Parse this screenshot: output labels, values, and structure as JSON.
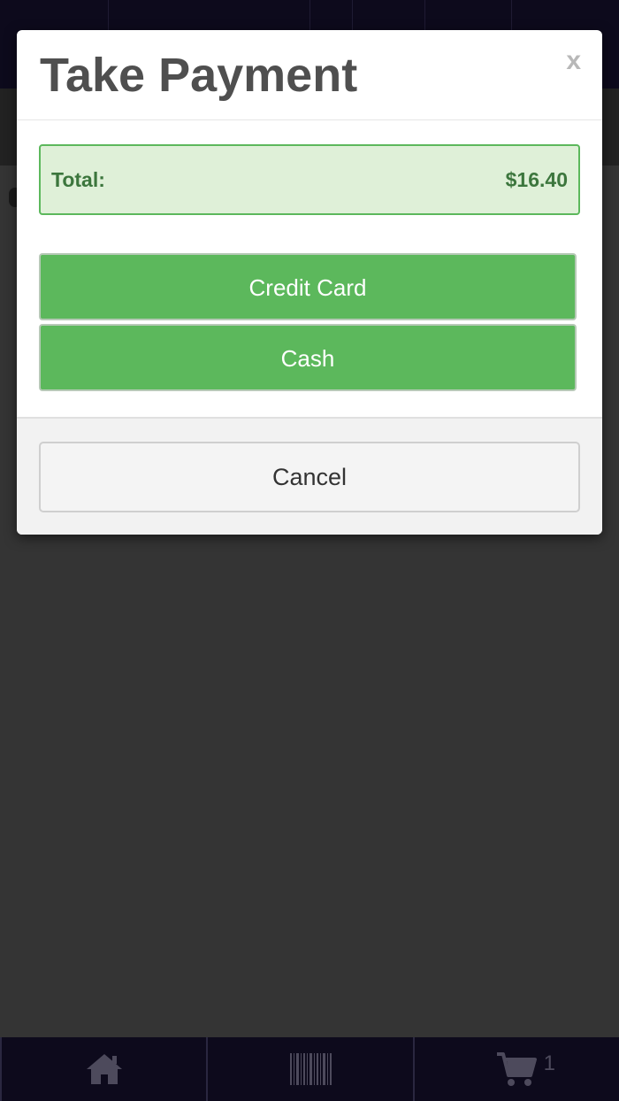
{
  "modal": {
    "title": "Take Payment",
    "close_label": "x",
    "total_label": "Total:",
    "total_value": "$16.40",
    "credit_card_label": "Credit Card",
    "cash_label": "Cash",
    "cancel_label": "Cancel"
  },
  "bottom_nav": {
    "cart_count": "1",
    "items": [
      "home-icon",
      "barcode-icon",
      "cart-icon"
    ]
  },
  "colors": {
    "accent_green": "#5cb85c",
    "total_bg": "#dff0d8",
    "total_text": "#3c763d",
    "nav_bg": "#0d0a1c"
  }
}
